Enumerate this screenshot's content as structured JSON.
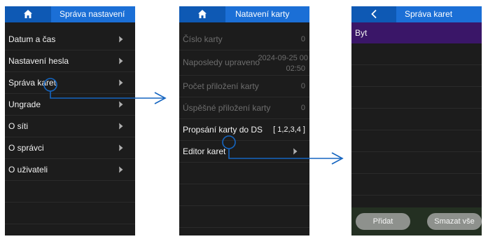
{
  "screen1": {
    "title": "Správa nastavení",
    "home_icon": "home-icon",
    "items": [
      {
        "label": "Datum a čas"
      },
      {
        "label": "Nastavení hesla"
      },
      {
        "label": "Správa karet"
      },
      {
        "label": "Ungrade"
      },
      {
        "label": "O síti"
      },
      {
        "label": "O správci"
      },
      {
        "label": "O uživateli"
      }
    ]
  },
  "screen2": {
    "title": "Natavení karty",
    "home_icon": "home-icon",
    "rows": [
      {
        "label": "Číslo karty",
        "value": "0"
      },
      {
        "label": "Naposledy upraveno",
        "value": "2024-09-25 00",
        "value2": "02:50"
      },
      {
        "label": "Počet přiložení karty",
        "value": "0"
      },
      {
        "label": "Úspěšné přiložení karty",
        "value": "0"
      },
      {
        "label": "Propsání karty do DS",
        "value": "[ 1,2,3,4 ]"
      },
      {
        "label": "Editor karet"
      }
    ]
  },
  "screen3": {
    "title": "Správa karet",
    "back_icon": "chevron-left-icon",
    "selected_item": "Byt",
    "add_button": "Přidat",
    "delete_all_button": "Smazat vše"
  },
  "colors": {
    "header_blue": "#1b6fd6",
    "header_dark_blue": "#0e59b4",
    "highlight_purple": "#3a1668",
    "arrow_blue": "#1565c0"
  }
}
